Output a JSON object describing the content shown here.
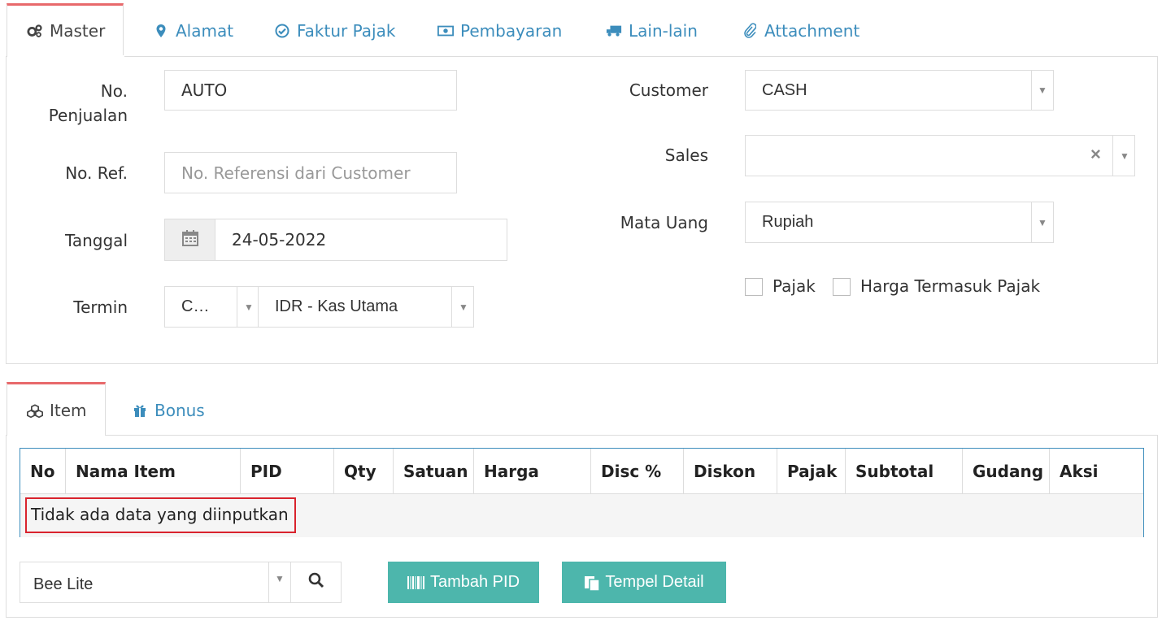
{
  "master_tabs": [
    {
      "label": "Master",
      "icon": "gears-icon",
      "active": true
    },
    {
      "label": "Alamat",
      "icon": "map-marker-icon"
    },
    {
      "label": "Faktur Pajak",
      "icon": "check-circle-icon"
    },
    {
      "label": "Pembayaran",
      "icon": "money-icon"
    },
    {
      "label": "Lain-lain",
      "icon": "truck-icon"
    },
    {
      "label": "Attachment",
      "icon": "paperclip-icon"
    }
  ],
  "form": {
    "no_penjualan": {
      "label_line1": "No.",
      "label_line2": "Penjualan",
      "value": "AUTO"
    },
    "no_ref": {
      "label": "No. Ref.",
      "placeholder": "No. Referensi dari Customer"
    },
    "tanggal": {
      "label": "Tanggal",
      "value": "24-05-2022"
    },
    "termin": {
      "label": "Termin",
      "value": "C…",
      "account": "IDR - Kas Utama"
    },
    "customer": {
      "label": "Customer",
      "value": "CASH"
    },
    "sales": {
      "label": "Sales",
      "value": "",
      "clear": "×"
    },
    "mata_uang": {
      "label": "Mata Uang",
      "value": "Rupiah"
    },
    "pajak": {
      "label": "Pajak",
      "checked": false
    },
    "harga_termasuk_pajak": {
      "label": "Harga Termasuk Pajak",
      "checked": false
    }
  },
  "detail_tabs": [
    {
      "label": "Item",
      "icon": "cubes-icon",
      "active": true
    },
    {
      "label": "Bonus",
      "icon": "gift-icon"
    }
  ],
  "table": {
    "columns": [
      "No",
      "Nama Item",
      "PID",
      "Qty",
      "Satuan",
      "Harga",
      "Disc %",
      "Diskon",
      "Pajak",
      "Subtotal",
      "Gudang",
      "Aksi"
    ],
    "empty_message": "Tidak ada data yang diinputkan"
  },
  "bottom": {
    "item_select": "Bee Lite",
    "tambah_pid": "Tambah PID",
    "tempel_detail": "Tempel Detail"
  },
  "colors": {
    "accent": "#3c8dbc",
    "tab_active_border": "#e8696b",
    "button": "#4db6ac",
    "highlight_box": "#d9232d"
  }
}
